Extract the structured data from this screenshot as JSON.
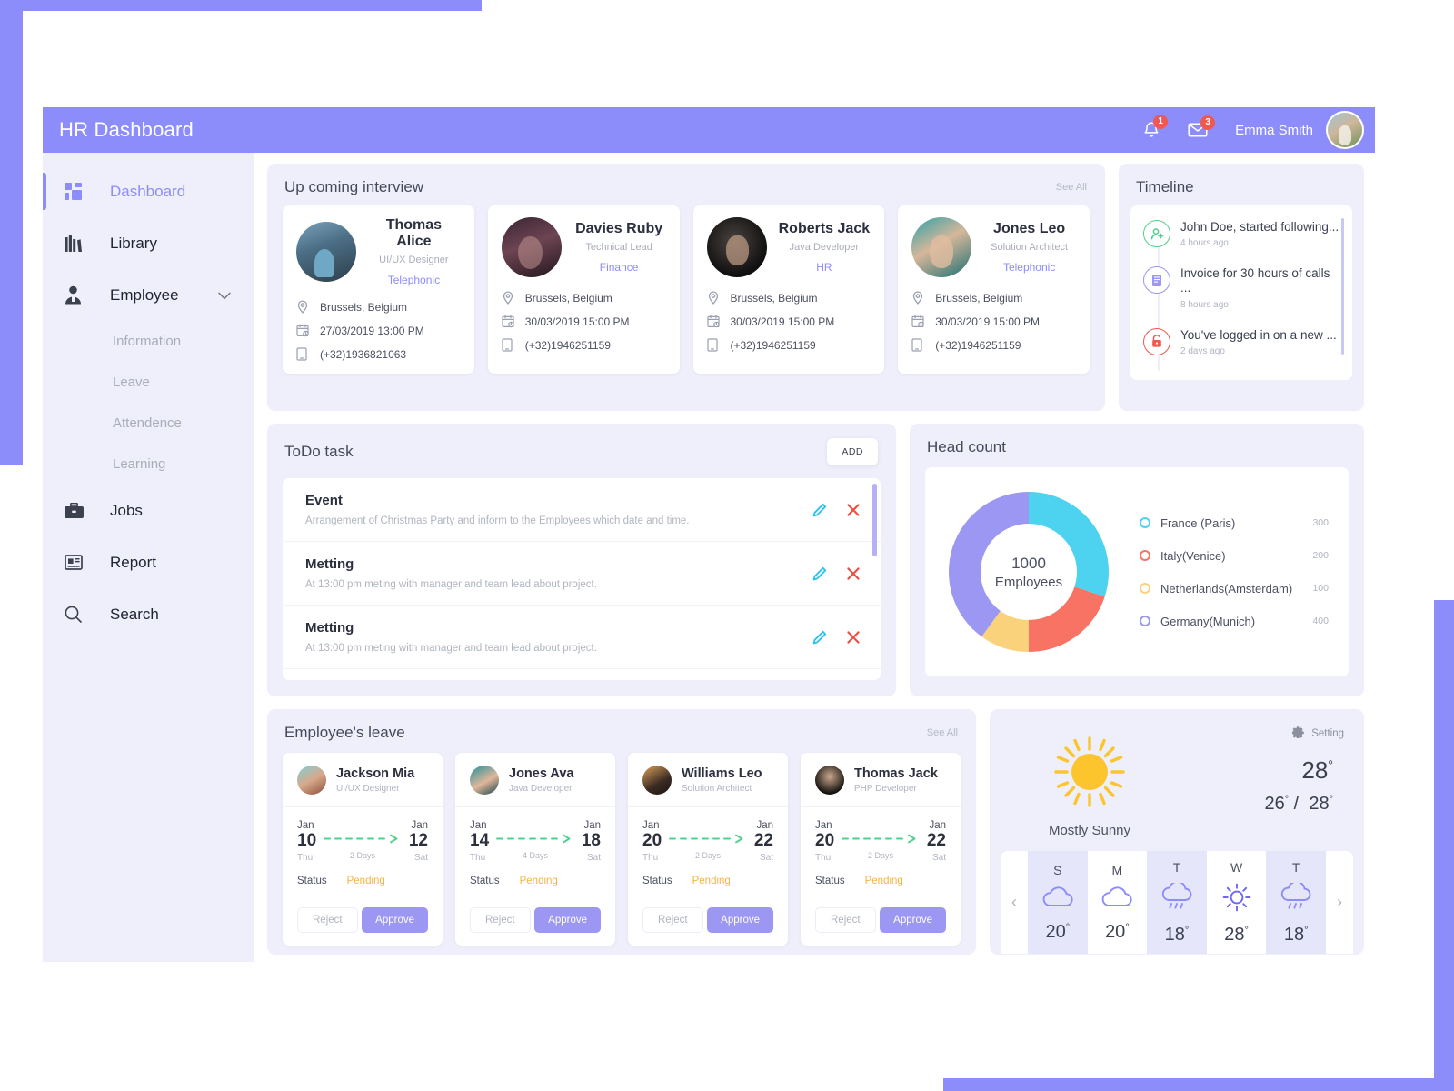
{
  "header": {
    "app_title": "HR Dashboard",
    "notification_badge": "1",
    "mail_badge": "3",
    "user_name": "Emma Smith"
  },
  "sidebar": {
    "items": [
      {
        "label": "Dashboard",
        "icon": "grid-icon"
      },
      {
        "label": "Library",
        "icon": "books-icon"
      },
      {
        "label": "Employee",
        "icon": "user-icon"
      },
      {
        "label": "Jobs",
        "icon": "briefcase-icon"
      },
      {
        "label": "Report",
        "icon": "report-icon"
      },
      {
        "label": "Search",
        "icon": "search-icon"
      }
    ],
    "sub_items": [
      "Information",
      "Leave",
      "Attendence",
      "Learning"
    ]
  },
  "interview": {
    "title": "Up coming interview",
    "see_all": "See All",
    "cards": [
      {
        "name": "Thomas Alice",
        "role": "UI/UX Designer",
        "type": "Telephonic",
        "location": "Brussels, Belgium",
        "datetime": "27/03/2019  13:00 PM",
        "phone": "(+32)1936821063"
      },
      {
        "name": "Davies Ruby",
        "role": "Technical Lead",
        "type": "Finance",
        "location": "Brussels, Belgium",
        "datetime": "30/03/2019  15:00 PM",
        "phone": "(+32)1946251159"
      },
      {
        "name": "Roberts Jack",
        "role": "Java Developer",
        "type": "HR",
        "location": "Brussels, Belgium",
        "datetime": "30/03/2019  15:00 PM",
        "phone": "(+32)1946251159"
      },
      {
        "name": "Jones Leo",
        "role": "Solution Architect",
        "type": "Telephonic",
        "location": "Brussels, Belgium",
        "datetime": "30/03/2019  15:00 PM",
        "phone": "(+32)1946251159"
      }
    ]
  },
  "timeline": {
    "title": "Timeline",
    "items": [
      {
        "text": "John Doe, started following...",
        "time": "4 hours ago",
        "icon": "user-plus-icon",
        "color": "#4fd18b"
      },
      {
        "text": "Invoice for 30 hours of calls ...",
        "time": "8 hours ago",
        "icon": "invoice-icon",
        "color": "#9b97f2"
      },
      {
        "text": "You've logged in on a new ...",
        "time": "2 days ago",
        "icon": "lock-open-icon",
        "color": "#f0594f"
      }
    ]
  },
  "todo": {
    "title": "ToDo task",
    "add_label": "ADD",
    "items": [
      {
        "title": "Event",
        "desc": "Arrangement of  Christmas Party and inform to the Employees which date and time."
      },
      {
        "title": "Metting",
        "desc": "At 13:00  pm  meting with manager and team lead about project."
      },
      {
        "title": "Metting",
        "desc": "At 13:00  pm  meting with manager and team lead about project."
      }
    ]
  },
  "chart_data": {
    "type": "pie",
    "title": "Head count",
    "center_value": "1000",
    "center_label": "Employees",
    "categories": [
      "France (Paris)",
      "Italy(Venice)",
      "Netherlands(Amsterdam)",
      "Germany(Munich)"
    ],
    "values": [
      300,
      200,
      100,
      400
    ],
    "colors": [
      "#4dd3f0",
      "#f87364",
      "#fbd27c",
      "#9b97f2"
    ],
    "legend_position": "right",
    "total": 1000
  },
  "leave": {
    "title": "Employee's leave",
    "see_all": "See All",
    "status_label": "Status",
    "reject_label": "Reject",
    "approve_label": "Approve",
    "cards": [
      {
        "name": "Jackson Mia",
        "role": "UI/UX Designer",
        "from_month": "Jan",
        "from_day": "10",
        "from_dow": "Thu",
        "to_month": "Jan",
        "to_day": "12",
        "to_dow": "Sat",
        "duration": "2 Days",
        "status": "Pending"
      },
      {
        "name": "Jones Ava",
        "role": "Java Developer",
        "from_month": "Jan",
        "from_day": "14",
        "from_dow": "Thu",
        "to_month": "Jan",
        "to_day": "18",
        "to_dow": "Sat",
        "duration": "4 Days",
        "status": "Pending"
      },
      {
        "name": "Williams Leo",
        "role": "Solution Architect",
        "from_month": "Jan",
        "from_day": "20",
        "from_dow": "Thu",
        "to_month": "Jan",
        "to_day": "22",
        "to_dow": "Sat",
        "duration": "2 Days",
        "status": "Pending"
      },
      {
        "name": "Thomas Jack",
        "role": "PHP Developer",
        "from_month": "Jan",
        "from_day": "20",
        "from_dow": "Thu",
        "to_month": "Jan",
        "to_day": "22",
        "to_dow": "Sat",
        "duration": "2 Days",
        "status": "Pending"
      }
    ]
  },
  "weather": {
    "setting_label": "Setting",
    "condition": "Mostly Sunny",
    "temp_now": "28",
    "temp_low": "26",
    "temp_high": "28",
    "degree": "°",
    "forecast": [
      {
        "dow": "S",
        "icon": "cloud-icon",
        "temp": "20"
      },
      {
        "dow": "M",
        "icon": "cloud-icon",
        "temp": "20"
      },
      {
        "dow": "T",
        "icon": "rain-icon",
        "temp": "18"
      },
      {
        "dow": "W",
        "icon": "sun-small-icon",
        "temp": "28"
      },
      {
        "dow": "T",
        "icon": "rain-icon",
        "temp": "18"
      }
    ]
  }
}
